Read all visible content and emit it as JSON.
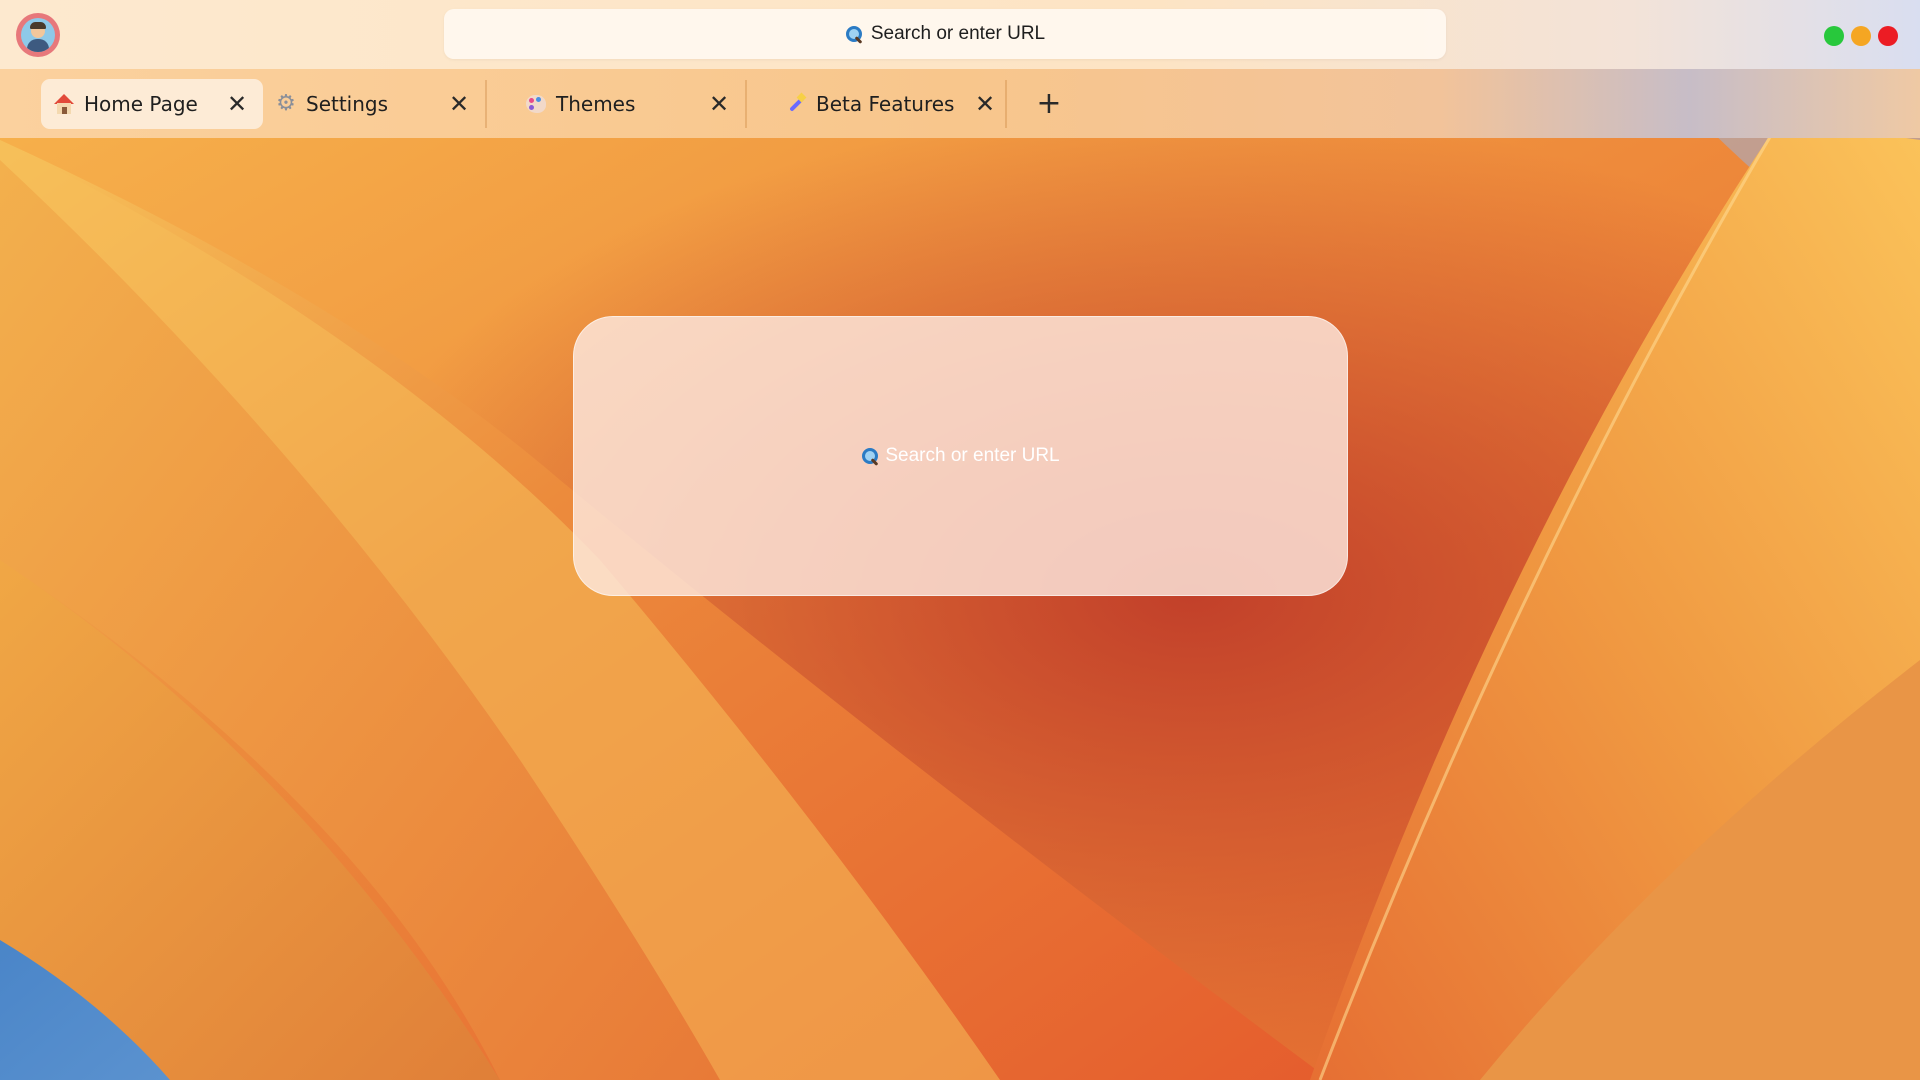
{
  "topbar": {
    "url_placeholder": "Search or enter URL",
    "search_icon": "magnifying-glass-icon",
    "avatar": "user-avatar",
    "window_controls": [
      {
        "name": "maximize",
        "color": "#28c83c"
      },
      {
        "name": "minimize",
        "color": "#f5a623"
      },
      {
        "name": "close",
        "color": "#ec1c24"
      }
    ]
  },
  "tabs": [
    {
      "label": "Home Page",
      "icon": "house-icon",
      "active": true,
      "close": "✕"
    },
    {
      "label": "Settings",
      "icon": "gear-icon",
      "active": false,
      "close": "✕"
    },
    {
      "label": "Themes",
      "icon": "palette-icon",
      "active": false,
      "close": "✕"
    },
    {
      "label": "Beta Features",
      "icon": "magic-wand-icon",
      "active": false,
      "close": "✕"
    }
  ],
  "new_tab": "+",
  "main": {
    "search_placeholder": "Search or enter URL"
  }
}
